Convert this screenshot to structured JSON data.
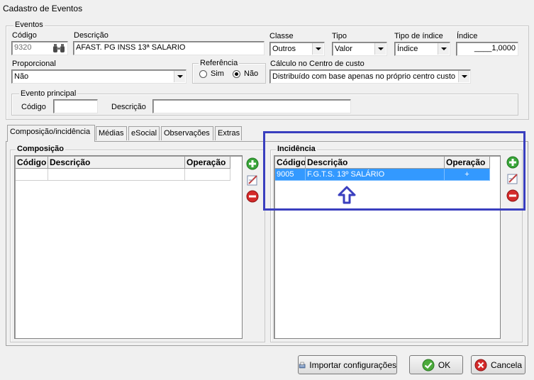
{
  "window": {
    "title": "Cadastro de Eventos"
  },
  "eventos": {
    "group_title": "Eventos",
    "codigo_label": "Código",
    "codigo_value": "9320",
    "descricao_label": "Descrição",
    "descricao_value": "AFAST. PG INSS 13ª SALARIO",
    "classe_label": "Classe",
    "classe_value": "Outros",
    "tipo_label": "Tipo",
    "tipo_value": "Valor",
    "tipo_indice_label": "Tipo de índice",
    "tipo_indice_value": "Índice",
    "indice_label": "Índice",
    "indice_value": "____1,0000",
    "proporcional_label": "Proporcional",
    "proporcional_value": "Não",
    "referencia_label": "Referência",
    "referencia_sim": "Sim",
    "referencia_nao": "Não",
    "referencia_selected": "Não",
    "calculo_label": "Cálculo no Centro de custo",
    "calculo_value": "Distribuído com base apenas no próprio centro custo",
    "principal_title": "Evento principal",
    "principal_codigo_label": "Código",
    "principal_codigo_value": "",
    "principal_descricao_label": "Descrição",
    "principal_descricao_value": ""
  },
  "tabs": [
    {
      "label": "Composição/incidência",
      "active": true
    },
    {
      "label": "Médias"
    },
    {
      "label": "eSocial"
    },
    {
      "label": "Observações"
    },
    {
      "label": "Extras"
    }
  ],
  "composicao": {
    "title": "Composição",
    "columns": [
      "Código",
      "Descrição",
      "Operação"
    ],
    "rows": []
  },
  "incidencia": {
    "title": "Incidência",
    "columns": [
      "Código",
      "Descrição",
      "Operação"
    ],
    "rows": [
      {
        "codigo": "9005",
        "descricao": "F.G.T.S. 13º SALÁRIO",
        "operacao": "+"
      }
    ]
  },
  "annotation": {
    "highlight_color": "#3a3fbf"
  },
  "buttons": {
    "importar": "Importar configurações",
    "ok": "OK",
    "cancelar": "Cancela"
  },
  "icons": {
    "binoculars": "binoculars-icon",
    "add": "add-icon",
    "edit": "edit-icon",
    "remove": "remove-icon",
    "import": "import-icon",
    "ok": "check-icon",
    "cancel": "cancel-icon",
    "arrow": "arrow-up-icon"
  }
}
